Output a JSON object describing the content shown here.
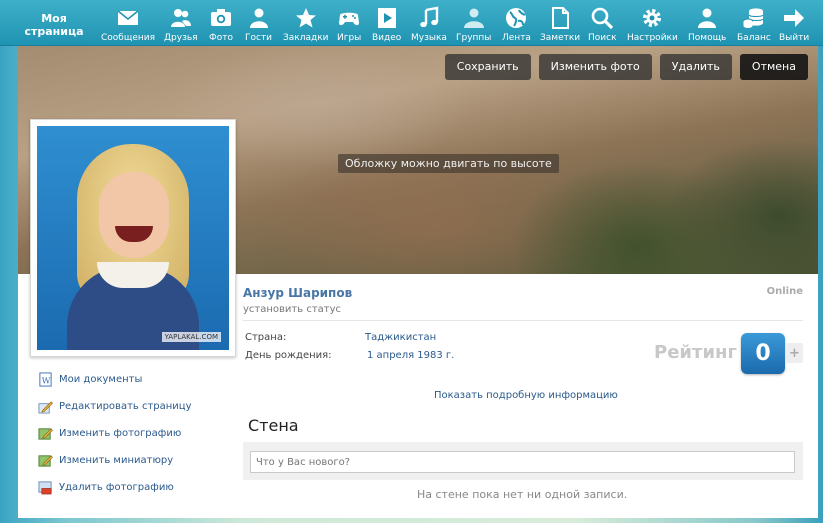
{
  "nav": {
    "my_page": "Моя страница",
    "items": [
      {
        "label": "Сообщения",
        "icon": "envelope-icon"
      },
      {
        "label": "Друзья",
        "icon": "friends-icon"
      },
      {
        "label": "Фото",
        "icon": "camera-icon"
      },
      {
        "label": "Гости",
        "icon": "guests-icon"
      },
      {
        "label": "Закладки",
        "icon": "star-icon"
      },
      {
        "label": "Игры",
        "icon": "gamepad-icon"
      },
      {
        "label": "Видео",
        "icon": "play-icon"
      },
      {
        "label": "Музыка",
        "icon": "music-note-icon"
      },
      {
        "label": "Группы",
        "icon": "groups-icon"
      },
      {
        "label": "Лента",
        "icon": "globe-icon"
      },
      {
        "label": "Заметки",
        "icon": "document-icon"
      },
      {
        "label": "Поиск",
        "icon": "search-icon"
      },
      {
        "label": "Настройки",
        "icon": "gear-icon"
      },
      {
        "label": "Помощь",
        "icon": "help-person-icon"
      },
      {
        "label": "Баланс",
        "icon": "coins-icon"
      },
      {
        "label": "Выйти",
        "icon": "arrow-right-icon"
      }
    ]
  },
  "cover": {
    "hint": "Обложку можно двигать по высоте",
    "buttons": {
      "save": "Сохранить",
      "change_photo": "Изменить фото",
      "delete": "Удалить",
      "cancel": "Отмена"
    }
  },
  "profile": {
    "name": "Анзур Шарипов",
    "status_link": "установить статус",
    "online": "Online",
    "photo_watermark": "YAPLAKAL.COM",
    "country_label": "Страна:",
    "country_value": "Таджикистан",
    "birthday_label": "День рождения:",
    "birthday_value": "1 апреля 1983 г.",
    "details_link": "Показать подробную информацию"
  },
  "rating": {
    "label": "Рейтинг",
    "value": "0",
    "plus": "+"
  },
  "sidebar": {
    "links": [
      {
        "label": "Мои документы",
        "icon": "word-document-icon"
      },
      {
        "label": "Редактировать страницу",
        "icon": "pencil-icon"
      },
      {
        "label": "Изменить фотографию",
        "icon": "edit-photo-icon"
      },
      {
        "label": "Изменить миниатюру",
        "icon": "edit-thumbnail-icon"
      },
      {
        "label": "Удалить фотографию",
        "icon": "delete-photo-icon"
      }
    ]
  },
  "wall": {
    "title": "Стена",
    "placeholder": "Что у Вас нового?",
    "empty": "На стене пока нет ни одной записи."
  }
}
